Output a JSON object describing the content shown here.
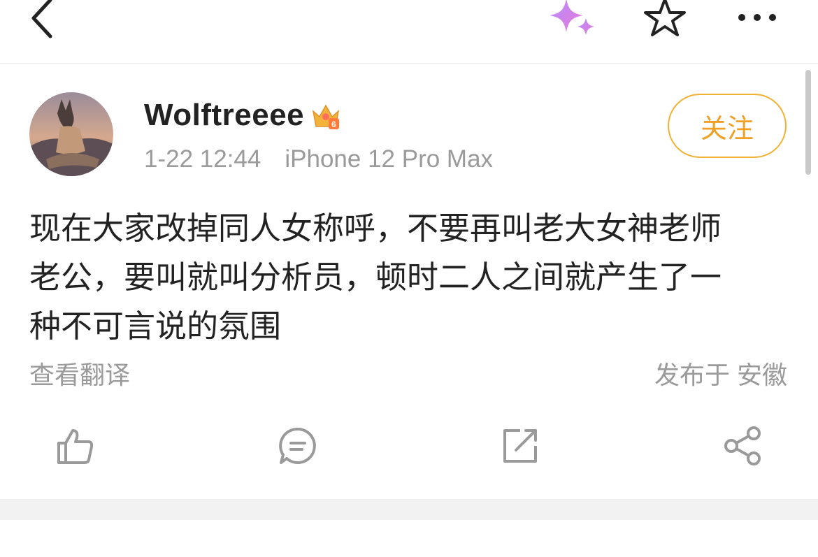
{
  "topbar": {
    "back_icon": "chevron-left-icon",
    "sparkle_icon": "ai-sparkle-icon",
    "star_icon": "star-outline-icon",
    "more_icon": "more-dots-icon"
  },
  "post": {
    "author": "Wolftreeee",
    "badge_icon": "vip-crown-icon",
    "badge_level": "6",
    "time": "1-22 12:44",
    "device": "iPhone 12 Pro Max",
    "follow_label": "关注",
    "text_lines": [
      "现在大家改掉同人女称呼，不要再叫老大女神老师",
      "老公，要叫就叫分析员，顿时二人之间就产生了一",
      "种不可言说的氛围"
    ],
    "translate_label": "查看翻译",
    "location_label": "发布于 安徽"
  },
  "actions": {
    "like_icon": "thumbs-up-icon",
    "comment_icon": "comment-icon",
    "repost_icon": "repost-icon",
    "share_icon": "share-icon"
  },
  "colors": {
    "accent": "#f0a024",
    "muted": "#9a9a9a",
    "text": "#222222"
  }
}
